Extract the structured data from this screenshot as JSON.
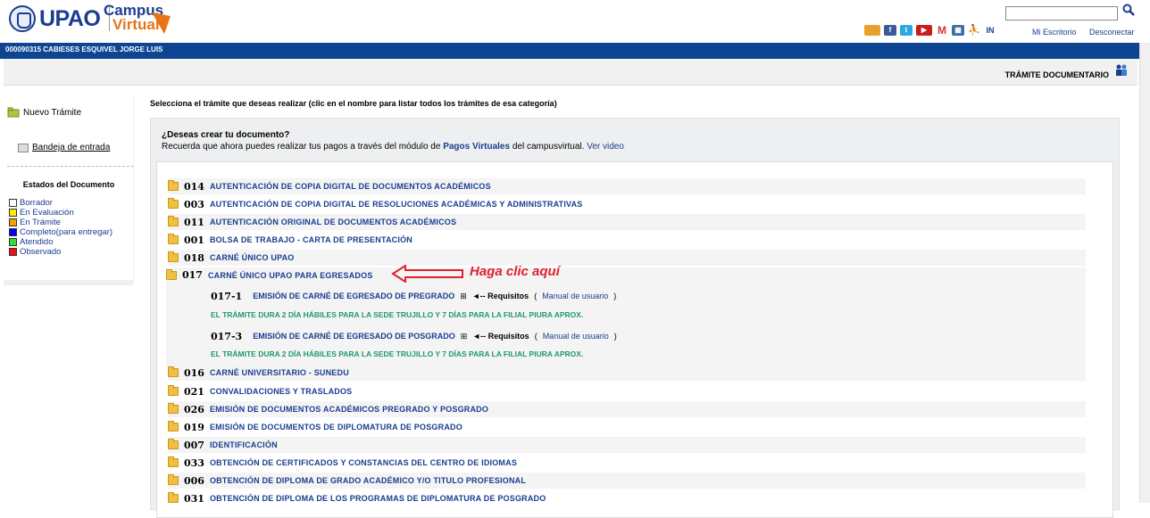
{
  "header": {
    "brand": "UPAO",
    "campus_line1": "Campus",
    "campus_line2": "Virtual",
    "search_placeholder": "",
    "mi_escritorio": "Mi Escritorio",
    "desconectar": "Desconectar",
    "social_icons": [
      "people-icon",
      "facebook-icon",
      "twitter-icon",
      "youtube-icon",
      "gmail-icon",
      "calendar-icon",
      "person-icon",
      "linkedin-icon"
    ]
  },
  "user_bar": {
    "user": "000090315   CABIESES ESQUIVEL JORGE LUIS"
  },
  "title_bar": {
    "title": "TRÁMITE DOCUMENTARIO"
  },
  "sidebar": {
    "new_label": "Nuevo Trámite",
    "inbox_label": "Bandeja de entrada",
    "estados_title": "Estados del Documento",
    "estados": [
      {
        "label": "Borrador",
        "color": "#ffffff"
      },
      {
        "label": "En Evaluación",
        "color": "#ffea00"
      },
      {
        "label": "En Trámite",
        "color": "#f0a000"
      },
      {
        "label": "Completo(para entregar)",
        "color": "#0000ee"
      },
      {
        "label": "Atendido",
        "color": "#33dd33"
      },
      {
        "label": "Observado",
        "color": "#ee1111"
      }
    ]
  },
  "main": {
    "instruction": "Selecciona el trámite que deseas realizar (clic en el nombre para listar todos los trámites de esa categoría)",
    "question": "¿Deseas crear tu documento?",
    "notice_pre": "Recuerda que ahora puedes realizar tus pagos a través del módulo de ",
    "notice_link": "Pagos Virtuales",
    "notice_post": " del campusvirtual.",
    "notice_video": "Ver video",
    "items_top": [
      {
        "code": "014",
        "title": "AUTENTICACIÓN DE COPIA DIGITAL DE DOCUMENTOS ACADÉMICOS"
      },
      {
        "code": "003",
        "title": "AUTENTICACIÓN DE COPIA DIGITAL DE RESOLUCIONES ACADÉMICAS Y ADMINISTRATIVAS"
      },
      {
        "code": "011",
        "title": "AUTENTICACIÓN ORIGINAL DE DOCUMENTOS ACADÉMICOS"
      },
      {
        "code": "001",
        "title": "BOLSA DE TRABAJO - CARTA DE PRESENTACIÓN"
      },
      {
        "code": "018",
        "title": "CARNÉ ÚNICO UPAO"
      }
    ],
    "expanded": {
      "code": "017",
      "title": "CARNÉ ÚNICO UPAO PARA EGRESADOS",
      "callout": "Haga clic aquí",
      "subitems": [
        {
          "code": "017-1",
          "title": "EMISIÓN DE CARNÉ DE EGRESADO DE PREGRADO",
          "plus": "⊞",
          "req_label": "◄-- Requisitos",
          "open": "(",
          "manual": "Manual de usuario",
          "close": ")",
          "duration": "EL TRÁMITE DURA 2 DÍA HÁBILES PARA LA SEDE TRUJILLO Y 7 DÍAS PARA LA FILIAL PIURA APROX."
        },
        {
          "code": "017-3",
          "title": "EMISIÓN DE CARNÉ DE EGRESADO DE POSGRADO",
          "plus": "⊞",
          "req_label": "◄-- Requisitos",
          "open": "(",
          "manual": "Manual de usuario",
          "close": ")",
          "duration": "EL TRÁMITE DURA 2 DÍA HÁBILES PARA LA SEDE TRUJILLO Y 7 DÍAS PARA LA FILIAL PIURA APROX."
        }
      ]
    },
    "items_bottom": [
      {
        "code": "016",
        "title": "CARNÉ UNIVERSITARIO - SUNEDU"
      },
      {
        "code": "021",
        "title": "CONVALIDACIONES Y TRASLADOS"
      },
      {
        "code": "026",
        "title": "EMISIÓN DE DOCUMENTOS ACADÉMICOS PREGRADO Y POSGRADO"
      },
      {
        "code": "019",
        "title": "EMISIÓN DE DOCUMENTOS DE DIPLOMATURA DE POSGRADO"
      },
      {
        "code": "007",
        "title": "IDENTIFICACIÓN"
      },
      {
        "code": "033",
        "title": "OBTENCIÓN DE CERTIFICADOS Y CONSTANCIAS DEL CENTRO DE IDIOMAS"
      },
      {
        "code": "006",
        "title": "OBTENCIÓN DE DIPLOMA DE GRADO ACADÉMICO Y/O TITULO PROFESIONAL"
      },
      {
        "code": "031",
        "title": "OBTENCIÓN DE DIPLOMA DE LOS PROGRAMAS DE DIPLOMATURA DE POSGRADO"
      }
    ]
  }
}
